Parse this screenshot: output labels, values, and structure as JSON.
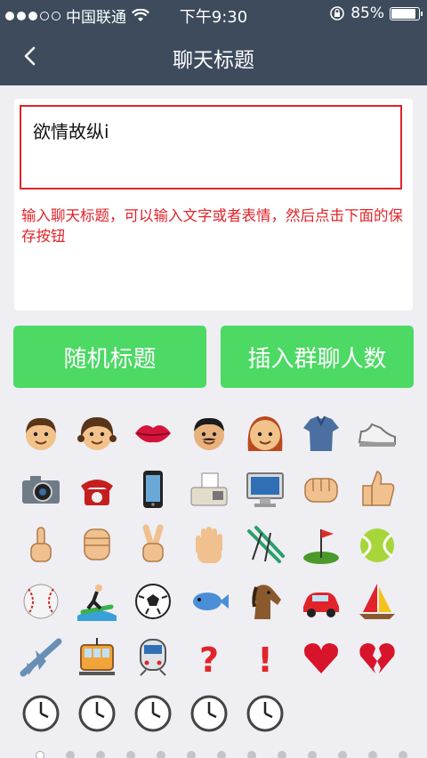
{
  "status": {
    "carrier": "中国联通",
    "time": "下午9:30",
    "battery": "85%",
    "battery_level": 0.85
  },
  "nav": {
    "title": "聊天标题"
  },
  "input": {
    "value": "欲情故纵i"
  },
  "hint": "输入聊天标题，可以输入文字或者表情，然后点击下面的保存按钮",
  "buttons": {
    "random": "随机标题",
    "insert": "插入群聊人数"
  },
  "emojis": [
    "boy-face-icon",
    "girl-face-icon",
    "kiss-lips-icon",
    "man-face-icon",
    "woman-face-icon",
    "shirt-icon",
    "sneaker-icon",
    "camera-icon",
    "telephone-icon",
    "mobile-phone-icon",
    "fax-icon",
    "computer-icon",
    "fist-icon",
    "thumbs-up-icon",
    "point-up-icon",
    "raised-fist-icon",
    "victory-hand-icon",
    "raised-hand-icon",
    "ski-icon",
    "golf-icon",
    "tennis-icon",
    "baseball-icon",
    "surfer-icon",
    "soccer-ball-icon",
    "fish-icon",
    "horse-icon",
    "car-icon",
    "sailboat-icon",
    "airplane-icon",
    "tram-icon",
    "train-icon",
    "question-mark-icon",
    "exclamation-icon",
    "heart-icon",
    "broken-heart-icon",
    "clock-icon",
    "clock-icon",
    "clock-icon",
    "clock-icon",
    "clock-icon"
  ],
  "colors": {
    "nav": "#3d4b5c",
    "accent": "#4cd964",
    "error": "#e0242a"
  }
}
